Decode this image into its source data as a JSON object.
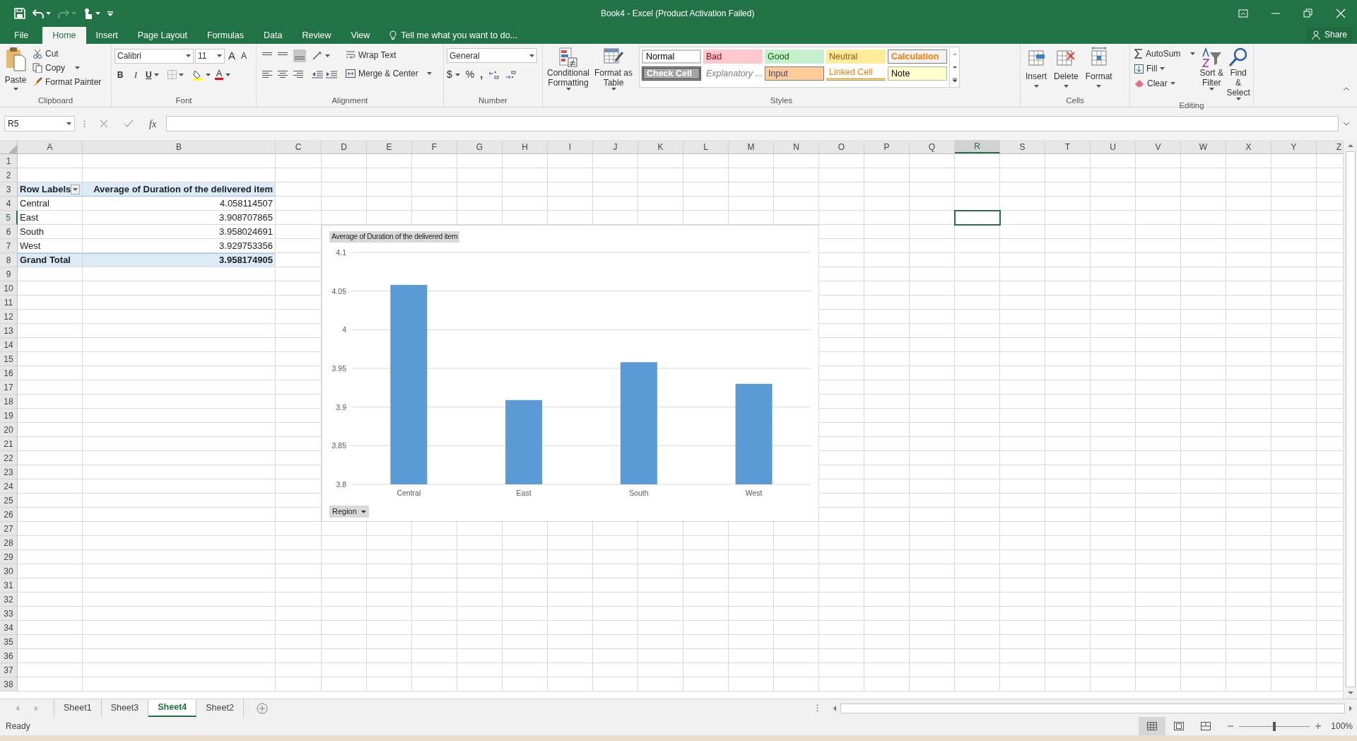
{
  "window": {
    "title": "Book4 - Excel (Product Activation Failed)"
  },
  "tabs": [
    {
      "label": "File",
      "selected": false
    },
    {
      "label": "Home",
      "selected": true
    },
    {
      "label": "Insert",
      "selected": false
    },
    {
      "label": "Page Layout",
      "selected": false
    },
    {
      "label": "Formulas",
      "selected": false
    },
    {
      "label": "Data",
      "selected": false
    },
    {
      "label": "Review",
      "selected": false
    },
    {
      "label": "View",
      "selected": false
    }
  ],
  "tell_me": {
    "placeholder": "Tell me what you want to do..."
  },
  "share": "Share",
  "ribbon": {
    "clipboard": {
      "label": "Clipboard",
      "paste": "Paste",
      "cut": "Cut",
      "copy": "Copy",
      "format_painter": "Format Painter"
    },
    "font": {
      "label": "Font",
      "name": "Calibri",
      "size": "11",
      "grow": "A",
      "shrink": "A",
      "bold": "B",
      "italic": "I",
      "underline": "U",
      "font_color": "A"
    },
    "alignment": {
      "label": "Alignment",
      "wrap_text": "Wrap Text",
      "merge_center": "Merge & Center"
    },
    "number": {
      "label": "Number",
      "format": "General",
      "currency": "$",
      "percent": "%",
      "comma": ","
    },
    "styles": {
      "label": "Styles",
      "conditional_formatting": "Conditional Formatting",
      "format_as_table": "Format as Table",
      "cells": [
        {
          "label": "Normal",
          "kind": "normal"
        },
        {
          "label": "Bad",
          "kind": "bad"
        },
        {
          "label": "Good",
          "kind": "good"
        },
        {
          "label": "Neutral",
          "kind": "neutral"
        },
        {
          "label": "Calculation",
          "kind": "calculation"
        },
        {
          "label": "Check Cell",
          "kind": "check"
        },
        {
          "label": "Explanatory ...",
          "kind": "explanatory"
        },
        {
          "label": "Input",
          "kind": "input"
        },
        {
          "label": "Linked Cell",
          "kind": "linked"
        },
        {
          "label": "Note",
          "kind": "note"
        }
      ]
    },
    "cells": {
      "label": "Cells",
      "insert": "Insert",
      "delete": "Delete",
      "format": "Format"
    },
    "editing": {
      "label": "Editing",
      "autosum": "AutoSum",
      "fill": "Fill",
      "clear": "Clear",
      "sort_filter": "Sort & Filter",
      "find_select": "Find & Select"
    }
  },
  "formula_bar": {
    "name_box": "R5",
    "fx": "fx"
  },
  "columns": [
    {
      "label": "A",
      "selected": false
    },
    {
      "label": "B",
      "selected": false
    },
    {
      "label": "C",
      "selected": false
    },
    {
      "label": "D",
      "selected": false
    },
    {
      "label": "E",
      "selected": false
    },
    {
      "label": "F",
      "selected": false
    },
    {
      "label": "G",
      "selected": false
    },
    {
      "label": "H",
      "selected": false
    },
    {
      "label": "I",
      "selected": false
    },
    {
      "label": "J",
      "selected": false
    },
    {
      "label": "K",
      "selected": false
    },
    {
      "label": "L",
      "selected": false
    },
    {
      "label": "M",
      "selected": false
    },
    {
      "label": "N",
      "selected": false
    },
    {
      "label": "O",
      "selected": false
    },
    {
      "label": "P",
      "selected": false
    },
    {
      "label": "Q",
      "selected": false
    },
    {
      "label": "R",
      "selected": true
    },
    {
      "label": "S",
      "selected": false
    },
    {
      "label": "T",
      "selected": false
    },
    {
      "label": "U",
      "selected": false
    },
    {
      "label": "V",
      "selected": false
    },
    {
      "label": "W",
      "selected": false
    },
    {
      "label": "X",
      "selected": false
    },
    {
      "label": "Y",
      "selected": false
    },
    {
      "label": "Z",
      "selected": false
    }
  ],
  "rows": [
    {
      "label": "1",
      "selected": false
    },
    {
      "label": "2",
      "selected": false
    },
    {
      "label": "3",
      "selected": false
    },
    {
      "label": "4",
      "selected": false
    },
    {
      "label": "5",
      "selected": true
    },
    {
      "label": "6",
      "selected": false
    },
    {
      "label": "7",
      "selected": false
    },
    {
      "label": "8",
      "selected": false
    },
    {
      "label": "9",
      "selected": false
    },
    {
      "label": "10",
      "selected": false
    },
    {
      "label": "11",
      "selected": false
    },
    {
      "label": "12",
      "selected": false
    },
    {
      "label": "13",
      "selected": false
    },
    {
      "label": "14",
      "selected": false
    },
    {
      "label": "15",
      "selected": false
    },
    {
      "label": "16",
      "selected": false
    },
    {
      "label": "17",
      "selected": false
    },
    {
      "label": "18",
      "selected": false
    },
    {
      "label": "19",
      "selected": false
    },
    {
      "label": "20",
      "selected": false
    },
    {
      "label": "21",
      "selected": false
    },
    {
      "label": "22",
      "selected": false
    },
    {
      "label": "23",
      "selected": false
    },
    {
      "label": "24",
      "selected": false
    },
    {
      "label": "25",
      "selected": false
    },
    {
      "label": "26",
      "selected": false
    },
    {
      "label": "27",
      "selected": false
    },
    {
      "label": "28",
      "selected": false
    },
    {
      "label": "29",
      "selected": false
    },
    {
      "label": "30",
      "selected": false
    },
    {
      "label": "31",
      "selected": false
    },
    {
      "label": "32",
      "selected": false
    },
    {
      "label": "33",
      "selected": false
    },
    {
      "label": "34",
      "selected": false
    },
    {
      "label": "35",
      "selected": false
    },
    {
      "label": "36",
      "selected": false
    },
    {
      "label": "37",
      "selected": false
    },
    {
      "label": "38",
      "selected": false
    }
  ],
  "pivot": {
    "header": [
      "Row Labels",
      "Average of Duration of the delivered item"
    ],
    "rows": [
      {
        "label": "Central",
        "value": "4.058114507"
      },
      {
        "label": "East",
        "value": "3.908707865"
      },
      {
        "label": "South",
        "value": "3.958024691"
      },
      {
        "label": "West",
        "value": "3.929753356"
      }
    ],
    "total": {
      "label": "Grand Total",
      "value": "3.958174905"
    }
  },
  "chart": {
    "field_button": "Region",
    "chart_data": {
      "type": "bar",
      "title": "Average of Duration of the delivered item",
      "categories": [
        "Central",
        "East",
        "South",
        "West"
      ],
      "series": [
        {
          "color": "#5b9bd5",
          "values": [
            4.058,
            3.909,
            3.958,
            3.93
          ]
        }
      ],
      "grid": true,
      "ylim": [
        3.8,
        4.1
      ],
      "yticks": [
        {
          "value": 3.8,
          "label": "3.8"
        },
        {
          "value": 3.85,
          "label": "3.85"
        },
        {
          "value": 3.9,
          "label": "3.9"
        },
        {
          "value": 3.95,
          "label": "3.95"
        },
        {
          "value": 4,
          "label": "4"
        },
        {
          "value": 4.05,
          "label": "4.05"
        },
        {
          "value": 4.1,
          "label": "4.1"
        }
      ]
    }
  },
  "sheets": [
    {
      "label": "Sheet1",
      "selected": false
    },
    {
      "label": "Sheet3",
      "selected": false
    },
    {
      "label": "Sheet4",
      "selected": true
    },
    {
      "label": "Sheet2",
      "selected": false
    }
  ],
  "status_bar": {
    "mode": "Ready",
    "zoom": "100%",
    "zoom_level": {
      "level": 0.5
    }
  }
}
